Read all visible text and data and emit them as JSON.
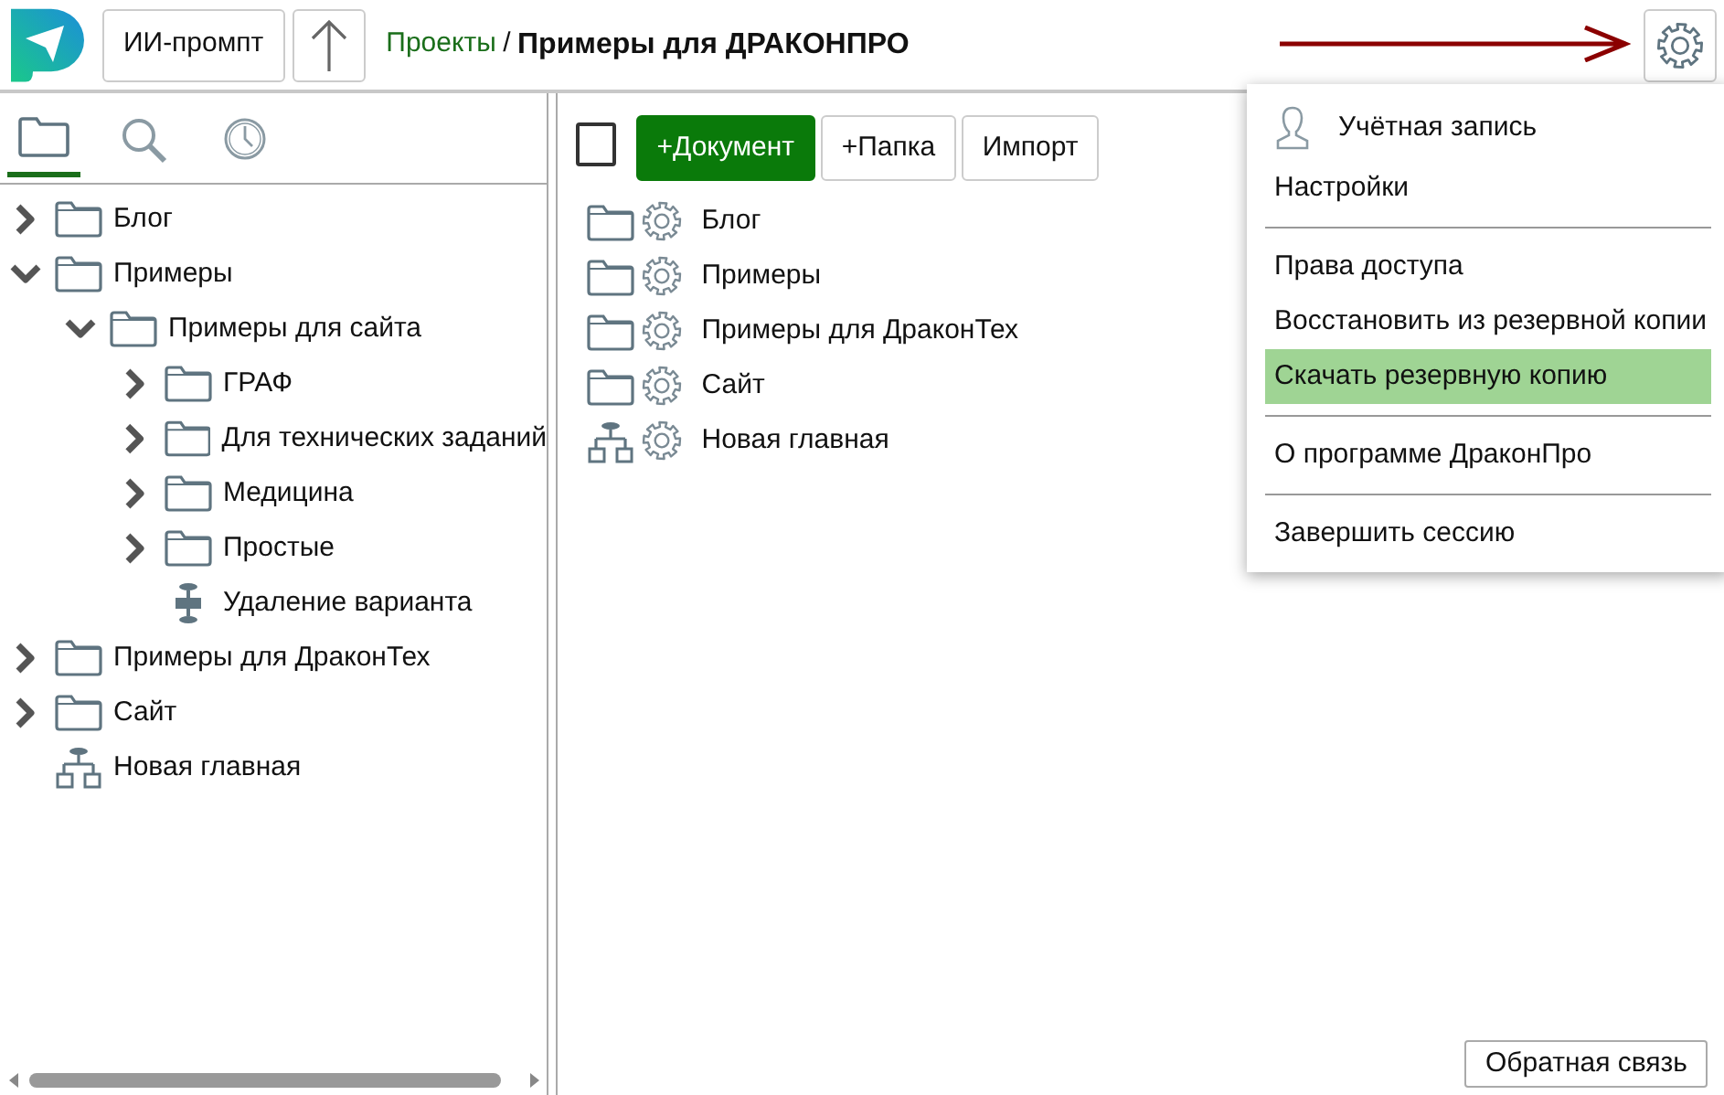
{
  "header": {
    "ai_prompt_button": "ИИ-промпт",
    "breadcrumb": {
      "link": "Проекты",
      "separator": "/",
      "current": "Примеры для ДРАКОНПРО"
    }
  },
  "sidebar_tabs": [
    {
      "kind": "folder",
      "selected": true
    },
    {
      "kind": "search",
      "selected": false
    },
    {
      "kind": "clock",
      "selected": false
    }
  ],
  "tree": [
    {
      "kind": "folder",
      "label": "Блог",
      "expanded": false
    },
    {
      "kind": "folder",
      "label": "Примеры",
      "expanded": true,
      "children": [
        {
          "kind": "folder",
          "label": "Примеры для сайта",
          "expanded": true,
          "children": [
            {
              "kind": "folder",
              "label": "ГРАФ",
              "expanded": false
            },
            {
              "kind": "folder",
              "label": "Для технических заданий",
              "expanded": false
            },
            {
              "kind": "folder",
              "label": "Медицина",
              "expanded": false
            },
            {
              "kind": "folder",
              "label": "Простые",
              "expanded": false
            },
            {
              "kind": "flow",
              "label": "Удаление варианта"
            }
          ]
        }
      ]
    },
    {
      "kind": "folder",
      "label": "Примеры для ДраконТех",
      "expanded": false
    },
    {
      "kind": "folder",
      "label": "Сайт",
      "expanded": false
    },
    {
      "kind": "tree",
      "label": "Новая главная"
    }
  ],
  "toolbar": {
    "select_all_checked": false,
    "buttons": [
      {
        "label": "+Документ",
        "kind": "primary"
      },
      {
        "label": "+Папка",
        "kind": "default"
      },
      {
        "label": "Импорт",
        "kind": "default"
      }
    ]
  },
  "list": [
    {
      "kind": "folder",
      "label": "Блог"
    },
    {
      "kind": "folder",
      "label": "Примеры"
    },
    {
      "kind": "folder",
      "label": "Примеры для ДраконТех"
    },
    {
      "kind": "folder",
      "label": "Сайт"
    },
    {
      "kind": "tree",
      "label": "Новая главная"
    }
  ],
  "settings_menu": {
    "groups": [
      [
        {
          "label": "Учётная запись",
          "kind": "account",
          "highlighted": false
        },
        {
          "label": "Настройки",
          "kind": "plain",
          "highlighted": false
        }
      ],
      [
        {
          "label": "Права доступа",
          "kind": "plain",
          "highlighted": false
        },
        {
          "label": "Восстановить из резервной копии",
          "kind": "plain",
          "highlighted": false
        },
        {
          "label": "Скачать резервную копию",
          "kind": "plain",
          "highlighted": true
        }
      ],
      [
        {
          "label": "О программе ДраконПро",
          "kind": "plain",
          "highlighted": false
        }
      ],
      [
        {
          "label": "Завершить сессию",
          "kind": "plain",
          "highlighted": false
        }
      ]
    ]
  },
  "feedback_button": "Обратная связь"
}
